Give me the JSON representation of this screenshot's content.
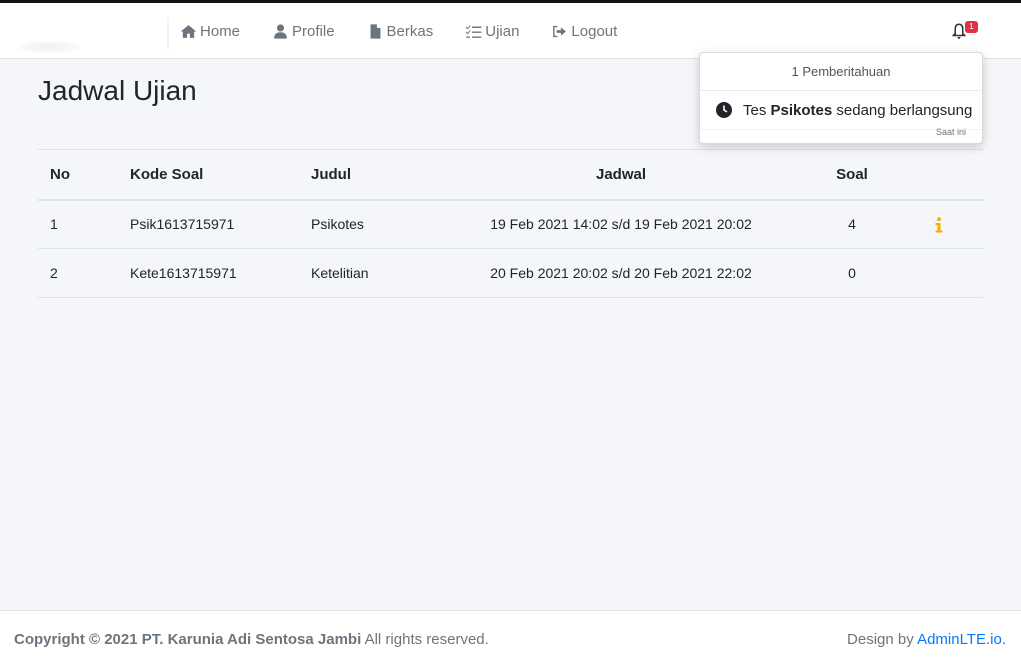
{
  "nav": {
    "items": [
      {
        "label": "Home",
        "icon": "home-icon"
      },
      {
        "label": "Profile",
        "icon": "user-icon"
      },
      {
        "label": "Berkas",
        "icon": "file-icon"
      },
      {
        "label": "Ujian",
        "icon": "tasks-icon"
      },
      {
        "label": "Logout",
        "icon": "sign-out-icon"
      }
    ],
    "notification_count": "1"
  },
  "page": {
    "title": "Jadwal Ujian"
  },
  "table": {
    "headers": {
      "no": "No",
      "kode": "Kode Soal",
      "judul": "Judul",
      "jadwal": "Jadwal",
      "soal": "Soal"
    },
    "rows": [
      {
        "no": "1",
        "kode": "Psik1613715971",
        "judul": "Psikotes",
        "jadwal": "19 Feb 2021 14:02 s/d 19 Feb 2021 20:02",
        "soal": "4",
        "has_info": true
      },
      {
        "no": "2",
        "kode": "Kete1613715971",
        "judul": "Ketelitian",
        "jadwal": "20 Feb 2021 20:02 s/d 20 Feb 2021 22:02",
        "soal": "0",
        "has_info": false
      }
    ]
  },
  "notifications": {
    "header": "1 Pemberitahuan",
    "item": {
      "prefix": "Tes ",
      "bold": "Psikotes",
      "suffix": " sedang berlangsung",
      "time": "Saat ini"
    }
  },
  "footer": {
    "copyright": "Copyright © 2021 PT. Karunia Adi Sentosa Jambi",
    "rights": " All rights reserved.",
    "design_prefix": "Design by ",
    "design_link": "AdminLTE.io."
  },
  "colors": {
    "accent": "#007bff",
    "badge": "#dc3545",
    "info_icon": "#f0b400",
    "background": "#f4f6f9"
  }
}
